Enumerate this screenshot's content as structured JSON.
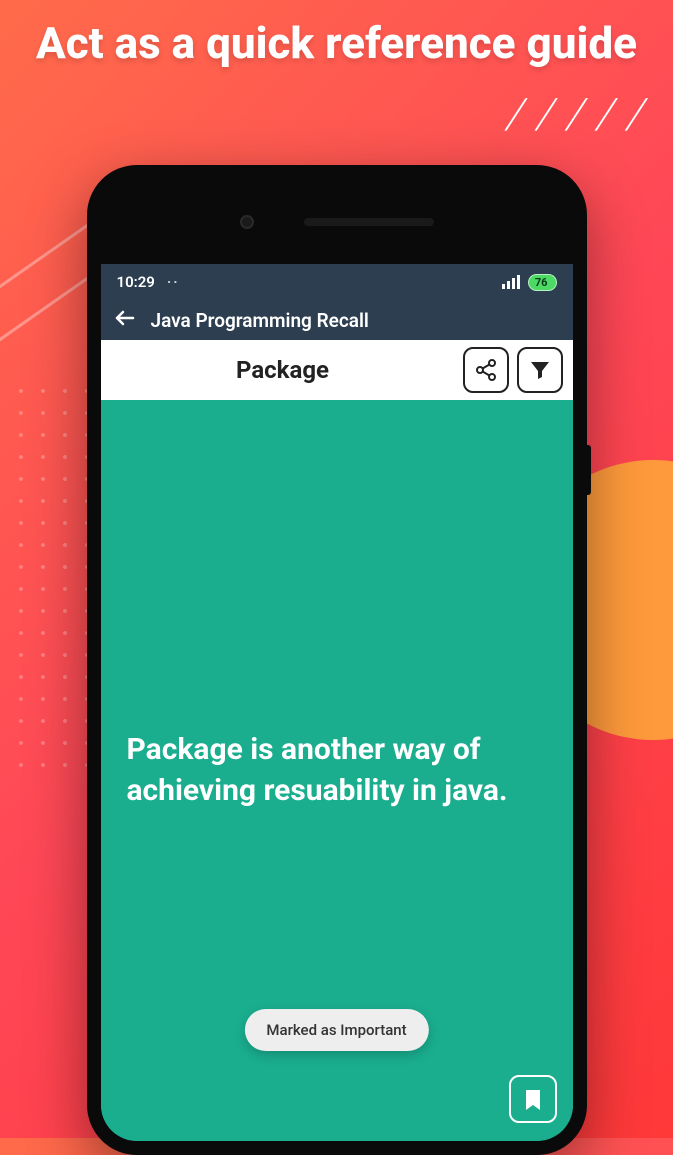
{
  "promo": {
    "headline": "Act as a quick reference guide"
  },
  "status": {
    "time": "10:29",
    "dots": "··",
    "battery": "76"
  },
  "appbar": {
    "title": "Java Programming Recall"
  },
  "topic": {
    "title": "Package"
  },
  "card": {
    "text": "Package is another way of achieving resuability in java."
  },
  "toast": {
    "message": "Marked as Important"
  }
}
